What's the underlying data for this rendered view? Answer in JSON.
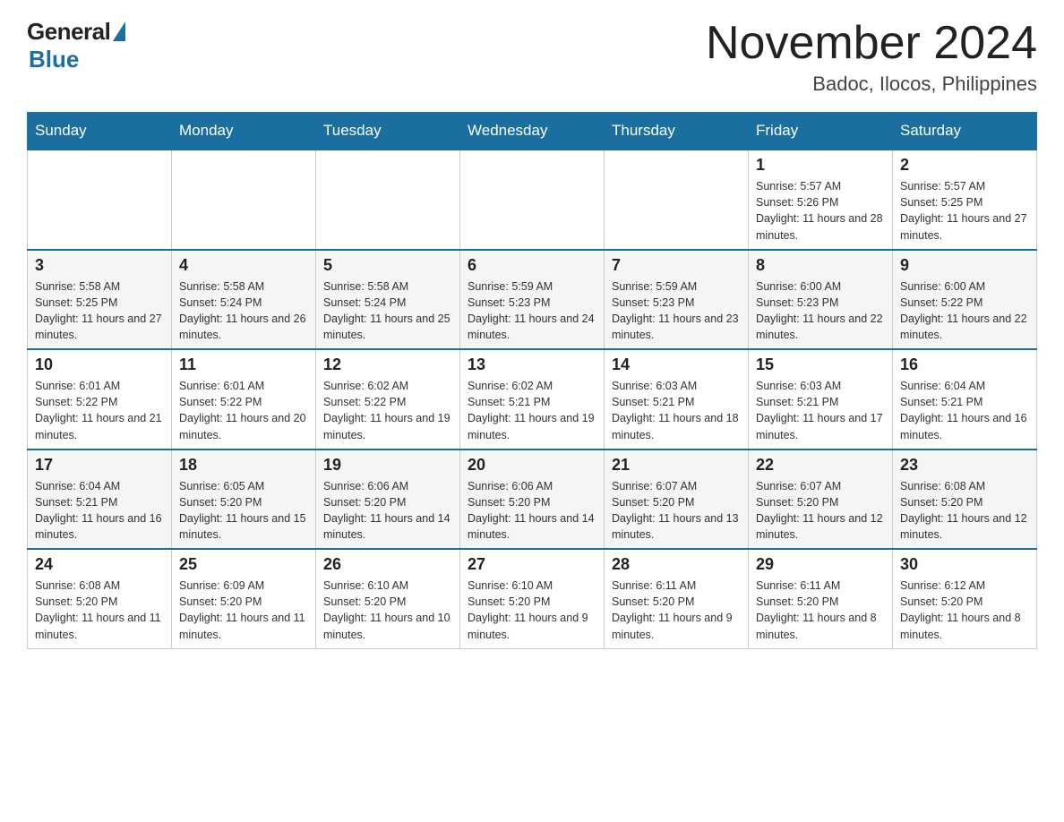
{
  "header": {
    "logo_general": "General",
    "logo_blue": "Blue",
    "month_title": "November 2024",
    "location": "Badoc, Ilocos, Philippines"
  },
  "days_of_week": [
    "Sunday",
    "Monday",
    "Tuesday",
    "Wednesday",
    "Thursday",
    "Friday",
    "Saturday"
  ],
  "weeks": [
    {
      "days": [
        {
          "number": "",
          "info": ""
        },
        {
          "number": "",
          "info": ""
        },
        {
          "number": "",
          "info": ""
        },
        {
          "number": "",
          "info": ""
        },
        {
          "number": "",
          "info": ""
        },
        {
          "number": "1",
          "info": "Sunrise: 5:57 AM\nSunset: 5:26 PM\nDaylight: 11 hours and 28 minutes."
        },
        {
          "number": "2",
          "info": "Sunrise: 5:57 AM\nSunset: 5:25 PM\nDaylight: 11 hours and 27 minutes."
        }
      ]
    },
    {
      "days": [
        {
          "number": "3",
          "info": "Sunrise: 5:58 AM\nSunset: 5:25 PM\nDaylight: 11 hours and 27 minutes."
        },
        {
          "number": "4",
          "info": "Sunrise: 5:58 AM\nSunset: 5:24 PM\nDaylight: 11 hours and 26 minutes."
        },
        {
          "number": "5",
          "info": "Sunrise: 5:58 AM\nSunset: 5:24 PM\nDaylight: 11 hours and 25 minutes."
        },
        {
          "number": "6",
          "info": "Sunrise: 5:59 AM\nSunset: 5:23 PM\nDaylight: 11 hours and 24 minutes."
        },
        {
          "number": "7",
          "info": "Sunrise: 5:59 AM\nSunset: 5:23 PM\nDaylight: 11 hours and 23 minutes."
        },
        {
          "number": "8",
          "info": "Sunrise: 6:00 AM\nSunset: 5:23 PM\nDaylight: 11 hours and 22 minutes."
        },
        {
          "number": "9",
          "info": "Sunrise: 6:00 AM\nSunset: 5:22 PM\nDaylight: 11 hours and 22 minutes."
        }
      ]
    },
    {
      "days": [
        {
          "number": "10",
          "info": "Sunrise: 6:01 AM\nSunset: 5:22 PM\nDaylight: 11 hours and 21 minutes."
        },
        {
          "number": "11",
          "info": "Sunrise: 6:01 AM\nSunset: 5:22 PM\nDaylight: 11 hours and 20 minutes."
        },
        {
          "number": "12",
          "info": "Sunrise: 6:02 AM\nSunset: 5:22 PM\nDaylight: 11 hours and 19 minutes."
        },
        {
          "number": "13",
          "info": "Sunrise: 6:02 AM\nSunset: 5:21 PM\nDaylight: 11 hours and 19 minutes."
        },
        {
          "number": "14",
          "info": "Sunrise: 6:03 AM\nSunset: 5:21 PM\nDaylight: 11 hours and 18 minutes."
        },
        {
          "number": "15",
          "info": "Sunrise: 6:03 AM\nSunset: 5:21 PM\nDaylight: 11 hours and 17 minutes."
        },
        {
          "number": "16",
          "info": "Sunrise: 6:04 AM\nSunset: 5:21 PM\nDaylight: 11 hours and 16 minutes."
        }
      ]
    },
    {
      "days": [
        {
          "number": "17",
          "info": "Sunrise: 6:04 AM\nSunset: 5:21 PM\nDaylight: 11 hours and 16 minutes."
        },
        {
          "number": "18",
          "info": "Sunrise: 6:05 AM\nSunset: 5:20 PM\nDaylight: 11 hours and 15 minutes."
        },
        {
          "number": "19",
          "info": "Sunrise: 6:06 AM\nSunset: 5:20 PM\nDaylight: 11 hours and 14 minutes."
        },
        {
          "number": "20",
          "info": "Sunrise: 6:06 AM\nSunset: 5:20 PM\nDaylight: 11 hours and 14 minutes."
        },
        {
          "number": "21",
          "info": "Sunrise: 6:07 AM\nSunset: 5:20 PM\nDaylight: 11 hours and 13 minutes."
        },
        {
          "number": "22",
          "info": "Sunrise: 6:07 AM\nSunset: 5:20 PM\nDaylight: 11 hours and 12 minutes."
        },
        {
          "number": "23",
          "info": "Sunrise: 6:08 AM\nSunset: 5:20 PM\nDaylight: 11 hours and 12 minutes."
        }
      ]
    },
    {
      "days": [
        {
          "number": "24",
          "info": "Sunrise: 6:08 AM\nSunset: 5:20 PM\nDaylight: 11 hours and 11 minutes."
        },
        {
          "number": "25",
          "info": "Sunrise: 6:09 AM\nSunset: 5:20 PM\nDaylight: 11 hours and 11 minutes."
        },
        {
          "number": "26",
          "info": "Sunrise: 6:10 AM\nSunset: 5:20 PM\nDaylight: 11 hours and 10 minutes."
        },
        {
          "number": "27",
          "info": "Sunrise: 6:10 AM\nSunset: 5:20 PM\nDaylight: 11 hours and 9 minutes."
        },
        {
          "number": "28",
          "info": "Sunrise: 6:11 AM\nSunset: 5:20 PM\nDaylight: 11 hours and 9 minutes."
        },
        {
          "number": "29",
          "info": "Sunrise: 6:11 AM\nSunset: 5:20 PM\nDaylight: 11 hours and 8 minutes."
        },
        {
          "number": "30",
          "info": "Sunrise: 6:12 AM\nSunset: 5:20 PM\nDaylight: 11 hours and 8 minutes."
        }
      ]
    }
  ]
}
